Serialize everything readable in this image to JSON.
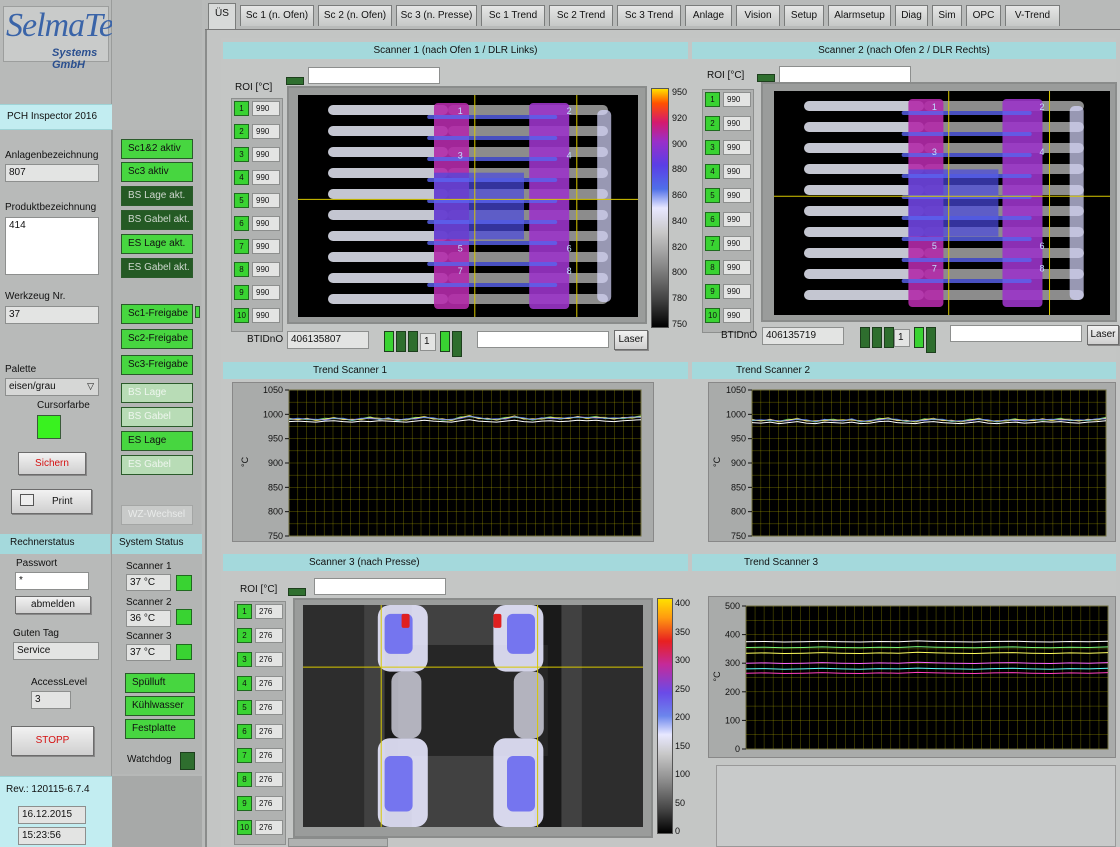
{
  "logo": {
    "brand": "SelmaTec",
    "sub": "Systems GmbH"
  },
  "app_title": "PCH Inspector 2016",
  "left": {
    "anlage_label": "Anlagenbezeichnung",
    "anlage_value": "807",
    "produkt_label": "Produktbezeichnung",
    "produkt_value": "414",
    "werkzeug_label": "Werkzeug Nr.",
    "werkzeug_value": "37",
    "palette_label": "Palette",
    "palette_value": "eisen/grau",
    "cursor_label": "Cursorfarbe",
    "cursor_color": "#39f21f",
    "save_label": "Sichern",
    "print_label": "Print",
    "rechnerstatus": "Rechnerstatus",
    "passwort_label": "Passwort",
    "passwort_value": "*",
    "abmelden_label": "abmelden",
    "guten_tag_label": "Guten Tag",
    "user_value": "Service",
    "access_label": "AccessLevel",
    "access_value": "3",
    "stopp_label": "STOPP",
    "rev": "Rev.: 120115-6.7.4",
    "date": "16.12.2015",
    "time": "15:23:56"
  },
  "mid": {
    "buttons": [
      {
        "label": "Sc1&2 aktiv",
        "state": "on"
      },
      {
        "label": "Sc3 aktiv",
        "state": "on"
      },
      {
        "label": "BS Lage akt.",
        "state": "off"
      },
      {
        "label": "BS Gabel akt.",
        "state": "off"
      },
      {
        "label": "ES Lage akt.",
        "state": "on"
      },
      {
        "label": "ES Gabel akt.",
        "state": "off"
      }
    ],
    "freigabe": [
      {
        "label": "Sc1-Freigabe",
        "state": "on"
      },
      {
        "label": "Sc2-Freigabe",
        "state": "on"
      },
      {
        "label": "Sc3-Freigabe",
        "state": "on"
      },
      {
        "label": "BS Lage",
        "state": "dim"
      },
      {
        "label": "BS Gabel",
        "state": "dim"
      },
      {
        "label": "ES Lage",
        "state": "on"
      },
      {
        "label": "ES Gabel",
        "state": "dim"
      }
    ],
    "wz_label": "WZ-Wechsel",
    "system_status": "System Status",
    "scanner1_label": "Scanner 1",
    "scanner1_temp": "37  °C",
    "scanner2_label": "Scanner 2",
    "scanner2_temp": "36  °C",
    "scanner3_label": "Scanner 3",
    "scanner3_temp": "37  °C",
    "status_buttons": [
      "Spülluft",
      "Kühlwasser",
      "Festplatte"
    ],
    "watchdog_label": "Watchdog"
  },
  "tabs": [
    "ÜS",
    "Sc 1 (n. Ofen)",
    "Sc 2 (n. Ofen)",
    "Sc 3 (n. Presse)",
    "Sc 1 Trend",
    "Sc 2 Trend",
    "Sc 3 Trend",
    "Anlage",
    "Vision",
    "Setup",
    "Alarmsetup",
    "Diag",
    "Sim",
    "OPC",
    "V-Trend"
  ],
  "scanner1": {
    "title": "Scanner 1 (nach Ofen 1 / DLR Links)",
    "roi_label": "ROI  [°C]",
    "roi_values": [
      "990",
      "990",
      "990",
      "990",
      "990",
      "990",
      "990",
      "990",
      "990",
      "990"
    ],
    "btid_label": "BTIDnO",
    "btid_value": "406135807",
    "counter": "1",
    "laser_label": "Laser",
    "scale_ticks": [
      "950",
      "920",
      "900",
      "880",
      "860",
      "840",
      "820",
      "800",
      "780",
      "750"
    ]
  },
  "scanner2": {
    "title": "Scanner 2 (nach Ofen 2 / DLR Rechts)",
    "roi_label": "ROI  [°C]",
    "roi_values": [
      "990",
      "990",
      "990",
      "990",
      "990",
      "990",
      "990",
      "990",
      "990",
      "990"
    ],
    "btid_label": "BTIDnO",
    "btid_value": "406135719",
    "counter": "1",
    "laser_label": "Laser"
  },
  "scanner3": {
    "title": "Scanner 3 (nach Presse)",
    "roi_label": "ROI  [°C]",
    "roi_values": [
      "276",
      "276",
      "276",
      "276",
      "276",
      "276",
      "276",
      "276",
      "276",
      "276"
    ],
    "scale_ticks": [
      "400",
      "350",
      "300",
      "250",
      "200",
      "150",
      "100",
      "50",
      "0"
    ]
  },
  "trend1": {
    "title": "Trend Scanner 1",
    "ylabel": "°C",
    "ticks": [
      "1050",
      "1000",
      "950",
      "900",
      "850",
      "800",
      "750"
    ]
  },
  "trend2": {
    "title": "Trend Scanner 2",
    "ylabel": "°C",
    "ticks": [
      "1050",
      "1000",
      "950",
      "900",
      "850",
      "800",
      "750"
    ]
  },
  "trend3": {
    "title": "Trend Scanner 3",
    "ylabel": "°C",
    "ticks": [
      "500",
      "400",
      "300",
      "200",
      "100",
      "0"
    ]
  },
  "chart_data": [
    {
      "type": "line",
      "title": "Trend Scanner 1",
      "ylabel": "°C",
      "ylim": [
        750,
        1050
      ],
      "series": [
        {
          "values": [
            990,
            990,
            991,
            989,
            990,
            992,
            990,
            989,
            991,
            993,
            990,
            991,
            989,
            990,
            992,
            994,
            991,
            990,
            989,
            993,
            996,
            992,
            991,
            990,
            992,
            995,
            991,
            990,
            992,
            993,
            991,
            992,
            995,
            993,
            994,
            992,
            991,
            993,
            994,
            995
          ]
        },
        {
          "values": [
            985,
            986,
            985,
            984,
            986,
            987,
            985,
            984,
            986,
            985,
            987,
            986,
            985,
            984,
            986,
            988,
            986,
            985,
            984,
            987,
            989,
            986,
            985,
            984,
            986,
            988,
            985,
            984,
            986,
            987,
            985,
            986,
            988,
            987,
            988,
            986,
            985,
            987,
            988,
            989
          ]
        }
      ],
      "colors": [
        "#ff66ff",
        "#ffffff",
        "#80ff80",
        "#ffff60",
        "#6080ff"
      ]
    },
    {
      "type": "line",
      "title": "Trend Scanner 2",
      "ylabel": "°C",
      "ylim": [
        750,
        1050
      ],
      "series": [
        {
          "values": [
            988,
            987,
            989,
            986,
            988,
            990,
            987,
            986,
            989,
            988,
            987,
            989,
            986,
            987,
            990,
            991,
            988,
            987,
            986,
            989,
            990,
            988,
            987,
            986,
            988,
            990,
            987,
            986,
            988,
            989,
            987,
            988,
            990,
            989,
            990,
            988,
            987,
            989,
            990,
            992
          ]
        },
        {
          "values": [
            983,
            982,
            984,
            981,
            983,
            985,
            982,
            981,
            984,
            983,
            982,
            984,
            981,
            982,
            985,
            986,
            983,
            982,
            981,
            984,
            985,
            983,
            982,
            981,
            983,
            985,
            982,
            981,
            983,
            984,
            982,
            983,
            985,
            984,
            985,
            983,
            982,
            984,
            985,
            987
          ]
        }
      ],
      "colors": [
        "#ff66ff",
        "#ffffff",
        "#80ff80",
        "#ffff60",
        "#6080ff"
      ]
    },
    {
      "type": "line",
      "title": "Trend Scanner 3",
      "ylabel": "°C",
      "ylim": [
        0,
        500
      ],
      "series": [
        {
          "values": [
            375,
            376,
            374,
            375,
            377,
            375,
            374,
            376,
            375,
            378,
            376,
            375,
            374,
            376,
            377,
            375,
            374,
            376,
            375,
            377
          ]
        },
        {
          "values": [
            355,
            356,
            354,
            355,
            357,
            355,
            354,
            356,
            355,
            358,
            356,
            355,
            354,
            356,
            357,
            355,
            354,
            356,
            355,
            357
          ]
        },
        {
          "values": [
            335,
            336,
            334,
            335,
            337,
            335,
            334,
            336,
            335,
            338,
            336,
            335,
            334,
            336,
            337,
            335,
            334,
            336,
            335,
            337
          ]
        },
        {
          "values": [
            300,
            301,
            299,
            300,
            302,
            300,
            299,
            301,
            300,
            303,
            301,
            300,
            299,
            301,
            302,
            300,
            299,
            301,
            300,
            302
          ]
        },
        {
          "values": [
            280,
            281,
            279,
            280,
            282,
            280,
            279,
            281,
            280,
            283,
            281,
            280,
            279,
            281,
            282,
            280,
            279,
            281,
            280,
            282
          ]
        },
        {
          "values": [
            265,
            266,
            264,
            265,
            267,
            265,
            264,
            266,
            265,
            268,
            266,
            265,
            264,
            266,
            267,
            265,
            264,
            266,
            265,
            267
          ]
        }
      ],
      "colors": [
        "#ffffff",
        "#80ff80",
        "#ffff60",
        "#ff66ff",
        "#60ffff",
        "#ff40c0"
      ]
    }
  ]
}
